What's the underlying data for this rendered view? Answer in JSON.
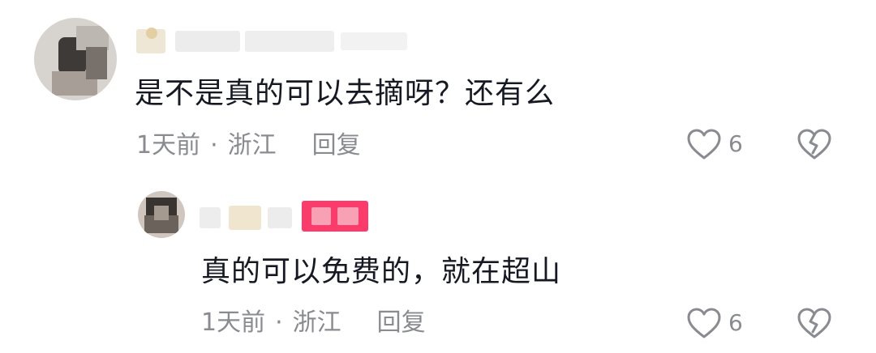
{
  "comments": [
    {
      "text": "是不是真的可以去摘呀？还有么",
      "time": "1天前",
      "separator": "·",
      "location": "浙江",
      "reply_label": "回复",
      "likes": "6"
    },
    {
      "text": "真的可以免费的，就在超山",
      "time": "1天前",
      "separator": "·",
      "location": "浙江",
      "reply_label": "回复",
      "likes": "6"
    }
  ],
  "icons": {
    "like": "heart-outline-icon",
    "dislike": "broken-heart-icon"
  },
  "colors": {
    "text": "#161823",
    "meta": "#8a8b91",
    "badge": "#fb3c6a"
  }
}
